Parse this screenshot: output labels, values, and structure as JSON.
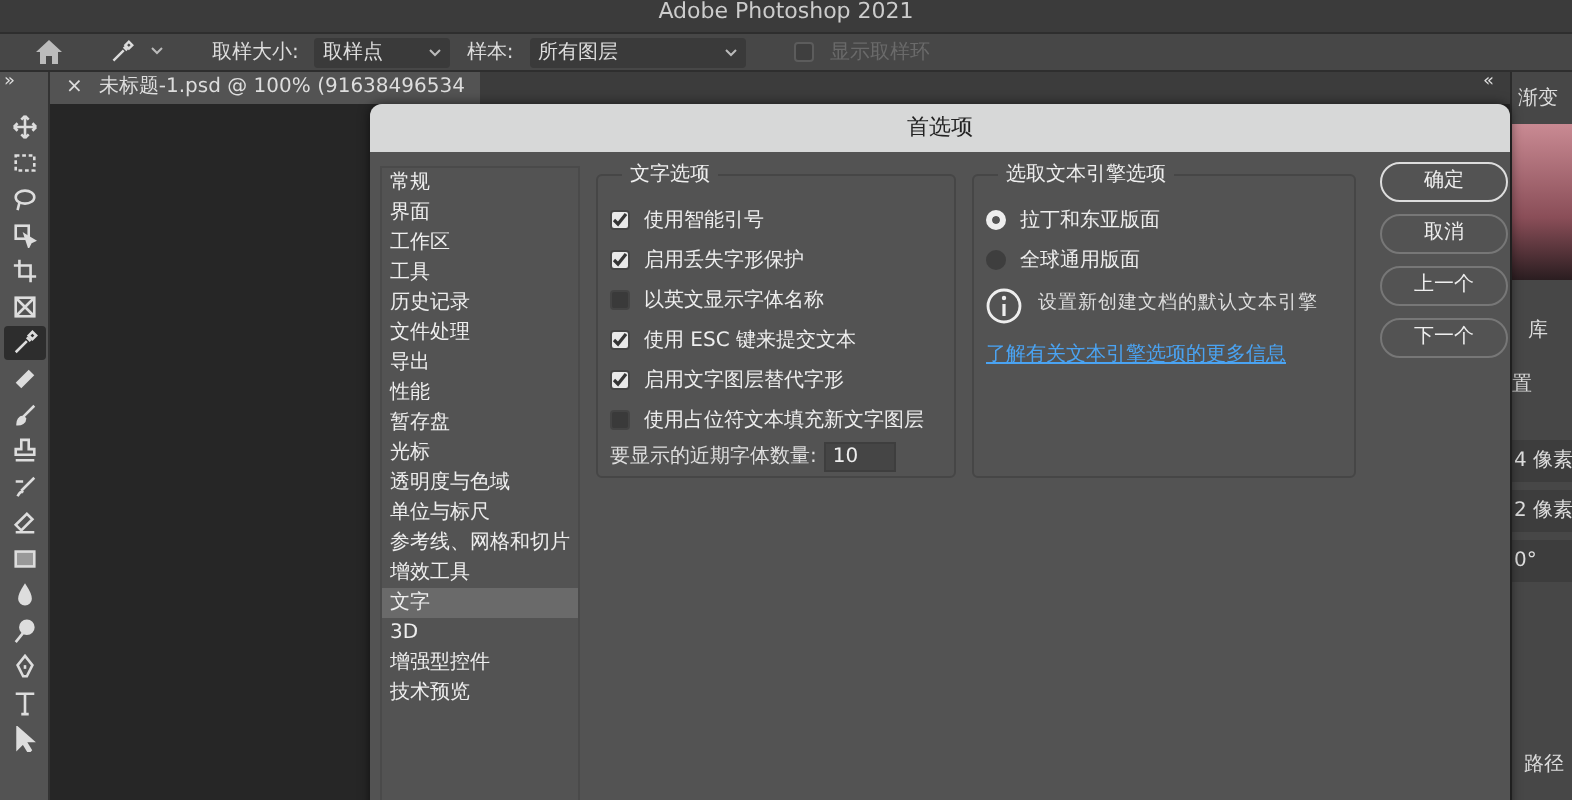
{
  "app": {
    "title": "Adobe Photoshop 2021"
  },
  "options_bar": {
    "sample_size_label": "取样大小:",
    "sample_size_value": "取样点",
    "sample_label": "样本:",
    "sample_value": "所有图层",
    "show_ring": {
      "label": "显示取样环",
      "checked": false,
      "disabled": true
    }
  },
  "panel_toggles": {
    "left": "»",
    "right": "«"
  },
  "document_tab": {
    "close": "×",
    "title": "未标题-1.psd @ 100% (91638496534"
  },
  "tools": [
    {
      "kind": "move",
      "selected": false
    },
    {
      "kind": "marquee",
      "selected": false
    },
    {
      "kind": "lasso",
      "selected": false
    },
    {
      "kind": "object-select",
      "selected": false
    },
    {
      "kind": "crop",
      "selected": false
    },
    {
      "kind": "frame",
      "selected": false
    },
    {
      "kind": "eyedropper",
      "selected": true
    },
    {
      "kind": "healing",
      "selected": false
    },
    {
      "kind": "brush",
      "selected": false
    },
    {
      "kind": "stamp",
      "selected": false
    },
    {
      "kind": "history-brush",
      "selected": false
    },
    {
      "kind": "eraser",
      "selected": false
    },
    {
      "kind": "gradient",
      "selected": false
    },
    {
      "kind": "blur",
      "selected": false
    },
    {
      "kind": "dodge",
      "selected": false
    },
    {
      "kind": "pen",
      "selected": false
    },
    {
      "kind": "type",
      "selected": false
    },
    {
      "kind": "path-select",
      "selected": false
    }
  ],
  "right_panel": {
    "gradient_tab": "渐变",
    "library_tab": "库",
    "property_label": "置",
    "values": [
      "4 像素",
      "2 像素",
      "0°"
    ],
    "paths_tab": "路径"
  },
  "dialog": {
    "title": "首选项",
    "categories": [
      {
        "label": "常规",
        "selected": false
      },
      {
        "label": "界面",
        "selected": false
      },
      {
        "label": "工作区",
        "selected": false
      },
      {
        "label": "工具",
        "selected": false
      },
      {
        "label": "历史记录",
        "selected": false
      },
      {
        "label": "文件处理",
        "selected": false
      },
      {
        "label": "导出",
        "selected": false
      },
      {
        "label": "性能",
        "selected": false
      },
      {
        "label": "暂存盘",
        "selected": false
      },
      {
        "label": "光标",
        "selected": false
      },
      {
        "label": "透明度与色域",
        "selected": false
      },
      {
        "label": "单位与标尺",
        "selected": false
      },
      {
        "label": "参考线、网格和切片",
        "selected": false
      },
      {
        "label": "增效工具",
        "selected": false
      },
      {
        "label": "文字",
        "selected": true
      },
      {
        "label": "3D",
        "selected": false
      },
      {
        "label": "增强型控件",
        "selected": false
      },
      {
        "label": "技术预览",
        "selected": false
      }
    ],
    "text_options": {
      "title": "文字选项",
      "checkboxes": [
        {
          "label": "使用智能引号",
          "checked": true
        },
        {
          "label": "启用丢失字形保护",
          "checked": true
        },
        {
          "label": "以英文显示字体名称",
          "checked": false
        },
        {
          "label": "使用 ESC 键来提交文本",
          "checked": true
        },
        {
          "label": "启用文字图层替代字形",
          "checked": true
        },
        {
          "label": "使用占位符文本填充新文字图层",
          "checked": false
        }
      ],
      "recent_fonts_label": "要显示的近期字体数量:",
      "recent_fonts_value": "10"
    },
    "engine_options": {
      "title": "选取文本引擎选项",
      "radios": [
        {
          "label": "拉丁和东亚版面",
          "selected": true
        },
        {
          "label": "全球通用版面",
          "selected": false
        }
      ],
      "info": "设置新创建文档的默认文本引擎",
      "link": "了解有关文本引擎选项的更多信息"
    },
    "buttons": [
      {
        "label": "确定",
        "default": true
      },
      {
        "label": "取消",
        "default": false
      },
      {
        "label": "上一个",
        "default": false
      },
      {
        "label": "下一个",
        "default": false
      }
    ]
  }
}
